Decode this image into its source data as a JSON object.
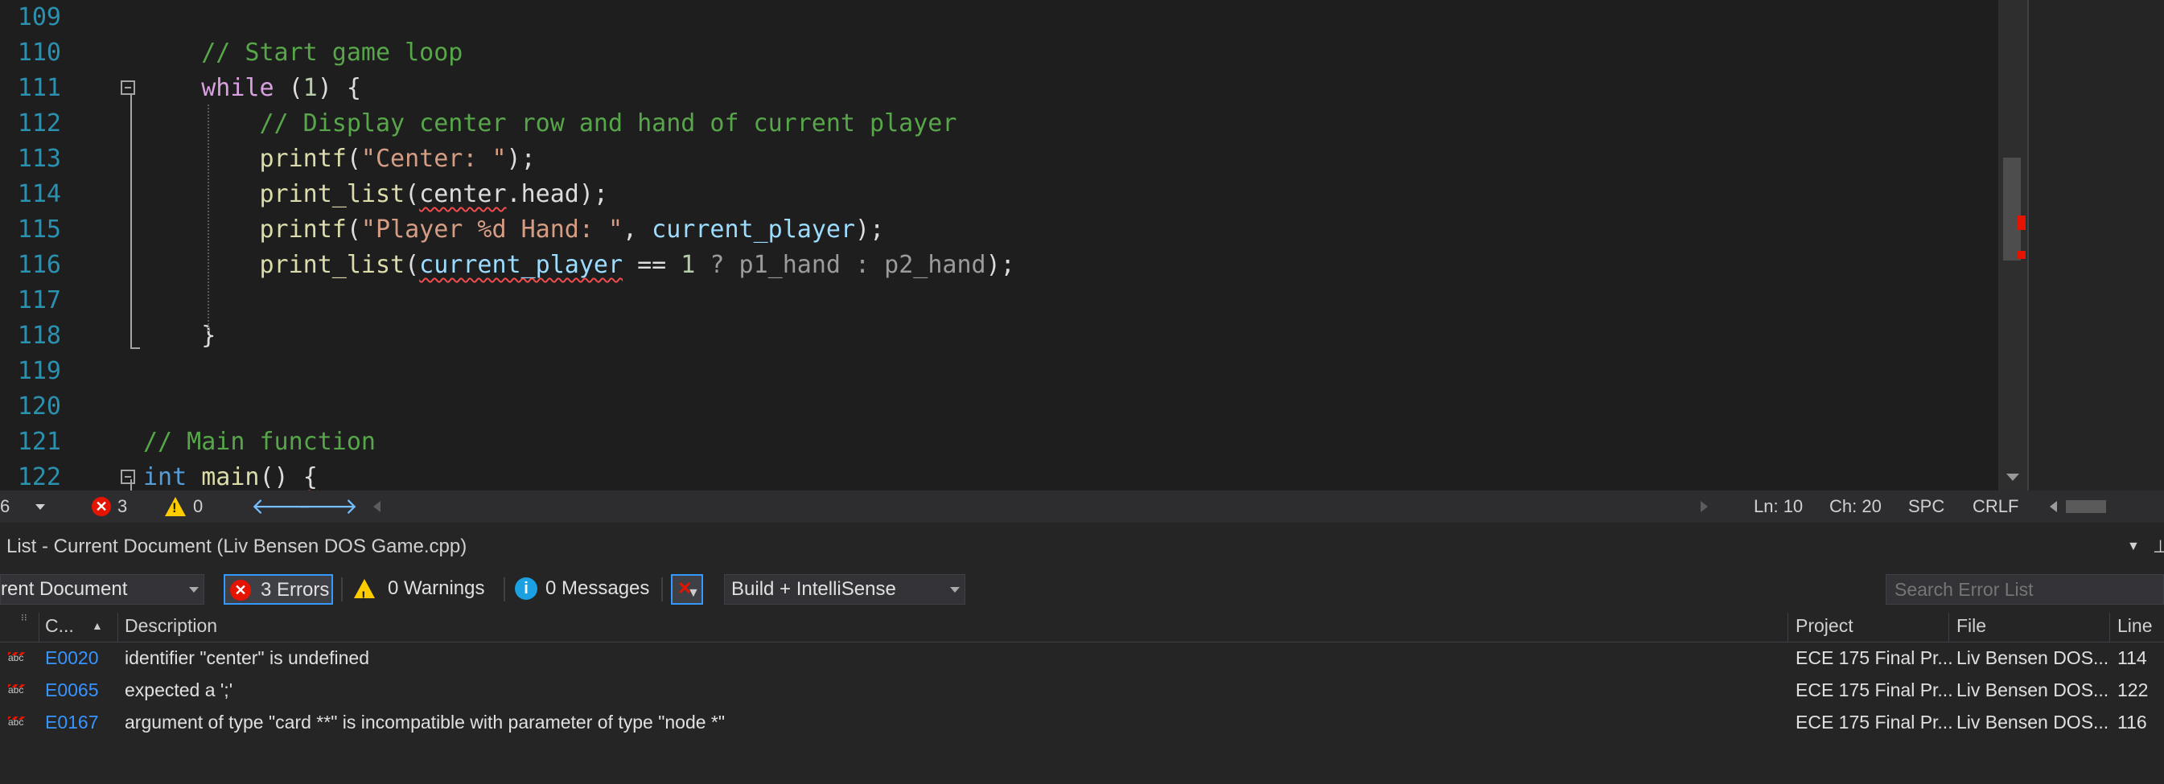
{
  "editor": {
    "lines": [
      {
        "num": "109",
        "tokens": []
      },
      {
        "num": "110",
        "tokens": [
          {
            "t": "// Start game loop",
            "c": "cmt"
          }
        ],
        "indent": 4
      },
      {
        "num": "111",
        "tokens": [
          {
            "t": "while",
            "c": "kw-ctrl"
          },
          {
            "t": " (",
            "c": ""
          },
          {
            "t": "1",
            "c": "num"
          },
          {
            "t": ") {",
            "c": ""
          }
        ],
        "indent": 4
      },
      {
        "num": "112",
        "tokens": [
          {
            "t": "// Display center row and hand of current player",
            "c": "cmt"
          }
        ],
        "indent": 8
      },
      {
        "num": "113",
        "tokens": [
          {
            "t": "printf",
            "c": "fn"
          },
          {
            "t": "(",
            "c": ""
          },
          {
            "t": "\"Center: \"",
            "c": "str"
          },
          {
            "t": ");",
            "c": ""
          }
        ],
        "indent": 8
      },
      {
        "num": "114",
        "tokens": [
          {
            "t": "print_list",
            "c": "fn"
          },
          {
            "t": "(",
            "c": ""
          },
          {
            "t": "center",
            "c": "squig"
          },
          {
            "t": ".head);",
            "c": ""
          }
        ],
        "indent": 8
      },
      {
        "num": "115",
        "tokens": [
          {
            "t": "printf",
            "c": "fn"
          },
          {
            "t": "(",
            "c": ""
          },
          {
            "t": "\"Player %d Hand: \"",
            "c": "str"
          },
          {
            "t": ", ",
            "c": ""
          },
          {
            "t": "current_player",
            "c": "var"
          },
          {
            "t": ");",
            "c": ""
          }
        ],
        "indent": 8
      },
      {
        "num": "116",
        "tokens": [
          {
            "t": "print_list",
            "c": "fn"
          },
          {
            "t": "(",
            "c": ""
          },
          {
            "t": "current_player",
            "c": "var squig"
          },
          {
            "t": " == ",
            "c": ""
          },
          {
            "t": "1",
            "c": "num"
          },
          {
            "t": " ? p1_hand : p2_hand",
            "c": "dim"
          },
          {
            "t": ");",
            "c": ""
          }
        ],
        "indent": 8
      },
      {
        "num": "117",
        "tokens": []
      },
      {
        "num": "118",
        "tokens": [
          {
            "t": "}",
            "c": ""
          }
        ],
        "indent": 4
      },
      {
        "num": "119",
        "tokens": []
      },
      {
        "num": "120",
        "tokens": []
      },
      {
        "num": "121",
        "tokens": [
          {
            "t": "// Main function",
            "c": "cmt"
          }
        ],
        "indent": 0
      },
      {
        "num": "122",
        "tokens": [
          {
            "t": "int",
            "c": "kw"
          },
          {
            "t": " ",
            "c": ""
          },
          {
            "t": "main",
            "c": "fn"
          },
          {
            "t": "() ",
            "c": ""
          },
          {
            "t": "{",
            "c": "squig"
          }
        ],
        "indent": 0
      }
    ]
  },
  "editor_status": {
    "zoom_fragment": "6",
    "error_count": "3",
    "warning_count": "0",
    "line": "Ln: 10",
    "char": "Ch: 20",
    "indent_mode": "SPC",
    "line_ending": "CRLF"
  },
  "error_list": {
    "title": "List - Current Document (Liv Bensen DOS Game.cpp)",
    "scope": "rent Document",
    "errors_button": "3 Errors",
    "warnings_button": "0 Warnings",
    "messages_button": "0 Messages",
    "build_filter": "Build + IntelliSense",
    "search_placeholder": "Search Error List",
    "columns": {
      "code": "C...",
      "description": "Description",
      "project": "Project",
      "file": "File",
      "line": "Line"
    },
    "rows": [
      {
        "code": "E0020",
        "description": "identifier \"center\" is undefined",
        "project": "ECE 175 Final Pr...",
        "file": "Liv Bensen DOS...",
        "line": "114"
      },
      {
        "code": "E0065",
        "description": "expected a ';'",
        "project": "ECE 175 Final Pr...",
        "file": "Liv Bensen DOS...",
        "line": "122"
      },
      {
        "code": "E0167",
        "description": "argument of type \"card **\" is incompatible with parameter of type \"node *\"",
        "project": "ECE 175 Final Pr...",
        "file": "Liv Bensen DOS...",
        "line": "116"
      }
    ],
    "icon_abc": "abc"
  },
  "colors": {
    "error_red": "#e51400",
    "warning_yellow": "#ffcc00",
    "info_blue": "#1ba1e2",
    "line_number": "#2b91af",
    "comment": "#57a64a"
  }
}
